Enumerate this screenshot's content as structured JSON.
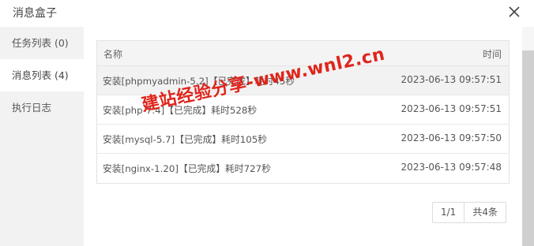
{
  "dialog": {
    "title": "消息盒子",
    "close_icon": "close-icon"
  },
  "sidebar": {
    "items": [
      {
        "label": "任务列表 (0)",
        "active": false
      },
      {
        "label": "消息列表 (4)",
        "active": true
      },
      {
        "label": "执行日志",
        "active": false
      }
    ]
  },
  "table": {
    "columns": {
      "name": "名称",
      "time": "时间"
    },
    "rows": [
      {
        "name": "安装[phpmyadmin-5.2]【已完成】耗时45秒",
        "time": "2023-06-13 09:57:51"
      },
      {
        "name": "安装[php-7.4]【已完成】耗时528秒",
        "time": "2023-06-13 09:57:51"
      },
      {
        "name": "安装[mysql-5.7]【已完成】耗时105秒",
        "time": "2023-06-13 09:57:50"
      },
      {
        "name": "安装[nginx-1.20]【已完成】耗时727秒",
        "time": "2023-06-13 09:57:48"
      }
    ]
  },
  "pagination": {
    "page": "1/1",
    "total": "共4条"
  },
  "watermark": {
    "text": "建站经验分享-www.wnl2.cn",
    "color": "#e0241b"
  },
  "colors": {
    "sidebar_bg": "#f2f2f2",
    "header_bg": "#f4f4f4",
    "watermark": "#e0241b"
  }
}
